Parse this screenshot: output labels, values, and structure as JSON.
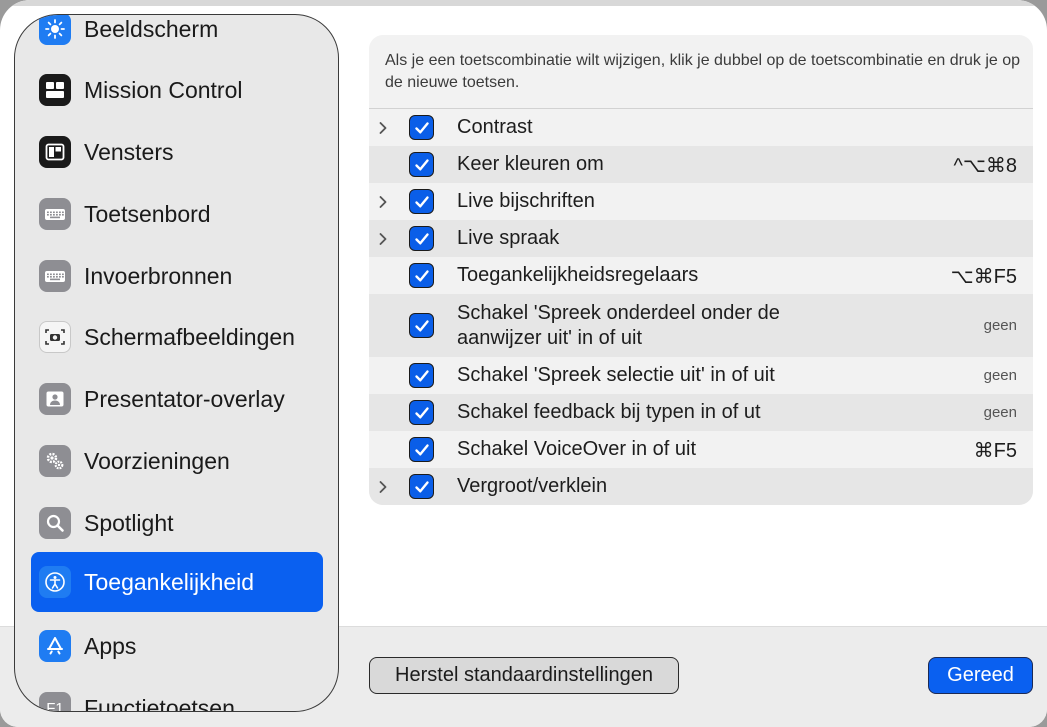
{
  "sidebar": {
    "items": [
      {
        "label": "Beeldscherm",
        "icon": "display-icon",
        "color": "#1f7cf2"
      },
      {
        "label": "Mission Control",
        "icon": "mission-control-icon",
        "color": "#1a1a1a"
      },
      {
        "label": "Vensters",
        "icon": "windows-icon",
        "color": "#1a1a1a"
      },
      {
        "label": "Toetsenbord",
        "icon": "keyboard-icon",
        "color": "#8e8e93"
      },
      {
        "label": "Invoerbronnen",
        "icon": "input-sources-icon",
        "color": "#8e8e93"
      },
      {
        "label": "Schermafbeeldingen",
        "icon": "screenshot-icon",
        "color": "#f5f5f5"
      },
      {
        "label": "Presentator-overlay",
        "icon": "presenter-overlay-icon",
        "color": "#8e8e93"
      },
      {
        "label": "Voorzieningen",
        "icon": "services-icon",
        "color": "#8e8e93"
      },
      {
        "label": "Spotlight",
        "icon": "spotlight-icon",
        "color": "#8e8e93"
      },
      {
        "label": "Toegankelijkheid",
        "icon": "accessibility-icon",
        "color": "#1f7cf2",
        "selected": true
      },
      {
        "label": "Apps",
        "icon": "apps-icon",
        "color": "#1f7cf2"
      },
      {
        "label": "Functietoetsen",
        "icon": "function-keys-icon",
        "color": "#8e8e93",
        "iconText": "F1"
      }
    ]
  },
  "main": {
    "info": "Als je een toetscombinatie wilt wijzigen, klik je dubbel op de toetscombinatie en druk je op de nieuwe toetsen.",
    "rows": [
      {
        "label": "Contrast",
        "expandable": true,
        "checked": true,
        "shortcut": ""
      },
      {
        "label": "Keer kleuren om",
        "expandable": false,
        "checked": true,
        "shortcut": "^⌥⌘8"
      },
      {
        "label": "Live bijschriften",
        "expandable": true,
        "checked": true,
        "shortcut": ""
      },
      {
        "label": "Live spraak",
        "expandable": true,
        "checked": true,
        "shortcut": ""
      },
      {
        "label": "Toegankelijkheidsregelaars",
        "expandable": false,
        "checked": true,
        "shortcut": "⌥⌘F5"
      },
      {
        "label": "Schakel 'Spreek onderdeel onder de",
        "label2": "aanwijzer uit' in of uit",
        "expandable": false,
        "checked": true,
        "shortcut": "geen"
      },
      {
        "label": "Schakel 'Spreek selectie uit' in of uit",
        "expandable": false,
        "checked": true,
        "shortcut": "geen"
      },
      {
        "label": "Schakel feedback bij typen in of ut",
        "expandable": false,
        "checked": true,
        "shortcut": "geen"
      },
      {
        "label": "Schakel VoiceOver in of uit",
        "expandable": false,
        "checked": true,
        "shortcut": "⌘F5"
      },
      {
        "label": "Vergroot/verklein",
        "expandable": true,
        "checked": true,
        "shortcut": ""
      }
    ]
  },
  "footer": {
    "reset_label": "Herstel standaardinstellingen",
    "done_label": "Gereed"
  },
  "colors": {
    "accent": "#0a60f0"
  }
}
